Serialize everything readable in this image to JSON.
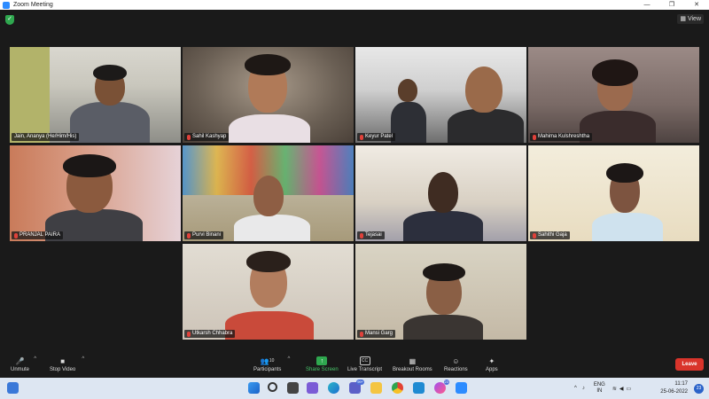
{
  "window": {
    "title": "Zoom Meeting",
    "minimize": "—",
    "maximize": "❐",
    "close": "✕"
  },
  "header": {
    "view_label": "View"
  },
  "participants": [
    {
      "name": "Jain, Ananya (He/Him/His)",
      "muted": false
    },
    {
      "name": "Sahil Kashyap",
      "muted": true
    },
    {
      "name": "Keyur Patel",
      "muted": true
    },
    {
      "name": "Mahima Kulshreshtha",
      "muted": true
    },
    {
      "name": "PRANJAL PAIRA",
      "muted": true
    },
    {
      "name": "Purvi Binani",
      "muted": true
    },
    {
      "name": "Tejasai",
      "muted": true
    },
    {
      "name": "Sahithi Gaja",
      "muted": true
    },
    {
      "name": "Utkarsh Chhabra",
      "muted": true
    },
    {
      "name": "Mansi Garg",
      "muted": true
    }
  ],
  "toolbar": {
    "unmute": "Unmute",
    "stop_video": "Stop Video",
    "participants": "Participants",
    "participants_count": "10",
    "share_screen": "Share Screen",
    "live_transcript": "Live Transcript",
    "breakout_rooms": "Breakout Rooms",
    "reactions": "Reactions",
    "apps": "Apps",
    "leave": "Leave",
    "cc_icon_text": "CC"
  },
  "taskbar": {
    "badge_teams": "99+",
    "badge_app": "23",
    "lang_line1": "ENG",
    "lang_line2": "IN",
    "time": "11:17",
    "date": "25-06-2022",
    "notification_count": "23"
  },
  "colors": {
    "accent_green": "#2fa84f",
    "leave_red": "#d9342b",
    "active_speaker": "#cde35a"
  }
}
